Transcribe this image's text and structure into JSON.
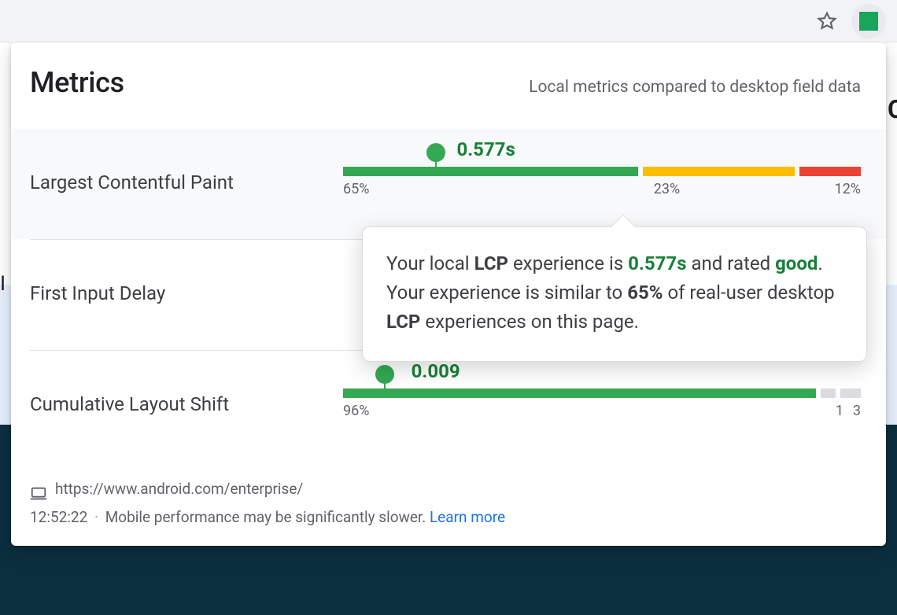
{
  "header": {
    "title": "Metrics",
    "subtitle": "Local metrics compared to desktop field data"
  },
  "metrics": [
    {
      "name": "Largest Contentful Paint",
      "value": "0.577s",
      "marker_percent": 18,
      "segments": [
        {
          "label": "65%",
          "pct": 58,
          "cls": "c-good"
        },
        {
          "label": "23%",
          "pct": 30,
          "cls": "c-ok"
        },
        {
          "label": "12%",
          "pct": 12,
          "cls": "c-bad"
        }
      ],
      "selected": true
    },
    {
      "name": "First Input Delay",
      "value": "",
      "marker_percent": null,
      "segments": [],
      "selected": false
    },
    {
      "name": "Cumulative Layout Shift",
      "value": "0.009",
      "marker_percent": 8,
      "segments": [
        {
          "label": "96%",
          "pct": 93,
          "cls": "c-good"
        },
        {
          "label": "1",
          "pct": 3,
          "cls": "c-na"
        },
        {
          "label": "3",
          "pct": 4,
          "cls": "c-na"
        }
      ],
      "selected": false
    }
  ],
  "tooltip": {
    "pre": "Your local ",
    "abbr1": "LCP",
    "mid1": " experience is ",
    "value": "0.577s",
    "mid2": " and rated ",
    "rating": "good",
    "post1": ". Your experience is similar to ",
    "pct": "65%",
    "post2": " of real-user desktop ",
    "abbr2": "LCP",
    "post3": " experiences on this page."
  },
  "footer": {
    "url": "https://www.android.com/enterprise/",
    "time": "12:52:22",
    "note": "Mobile performance may be significantly slower.",
    "link": "Learn more"
  },
  "colors": {
    "good": "#34a853",
    "ok": "#fbbc04",
    "bad": "#ea4335",
    "na": "#dadce0",
    "good_text": "#188038",
    "link": "#1a73e8"
  }
}
